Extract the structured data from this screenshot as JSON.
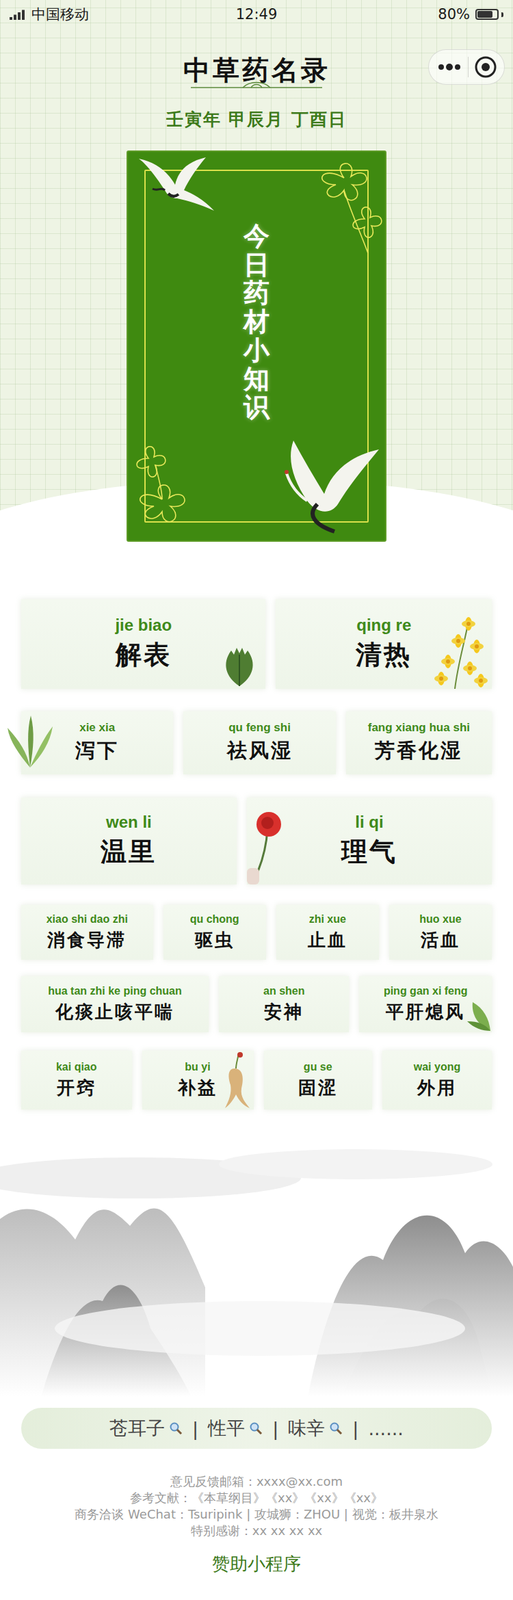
{
  "status_bar": {
    "carrier": "中国移动",
    "time": "12:49",
    "battery": "80%",
    "battery_level": 0.8,
    "signal_bars": 4
  },
  "header": {
    "title": "中草药名录",
    "date": "壬寅年 甲辰月 丁酉日"
  },
  "feature_card": {
    "title": "今日药材小知识"
  },
  "category_rows": [
    {
      "items": [
        {
          "pinyin": "jie biao",
          "name": "解表"
        },
        {
          "pinyin": "qing re",
          "name": "清热"
        }
      ]
    },
    {
      "items": [
        {
          "pinyin": "xie xia",
          "name": "泻下"
        },
        {
          "pinyin": "qu feng shi",
          "name": "祛风湿"
        },
        {
          "pinyin": "fang xiang hua shi",
          "name": "芳香化湿"
        }
      ]
    },
    {
      "items": [
        {
          "pinyin": "wen li",
          "name": "温里"
        },
        {
          "pinyin": "li qi",
          "name": "理气"
        }
      ]
    },
    {
      "items": [
        {
          "pinyin": "xiao shi dao zhi",
          "name": "消食导滞"
        },
        {
          "pinyin": "qu chong",
          "name": "驱虫"
        },
        {
          "pinyin": "zhi xue",
          "name": "止血"
        },
        {
          "pinyin": "huo xue",
          "name": "活血"
        }
      ]
    },
    {
      "items": [
        {
          "pinyin": "hua tan zhi ke ping chuan",
          "name": "化痰止咳平喘"
        },
        {
          "pinyin": "an shen",
          "name": "安神"
        },
        {
          "pinyin": "ping gan xi feng",
          "name": "平肝熄风"
        }
      ]
    },
    {
      "items": [
        {
          "pinyin": "kai qiao",
          "name": "开窍"
        },
        {
          "pinyin": "bu yi",
          "name": "补益"
        },
        {
          "pinyin": "gu se",
          "name": "固涩"
        },
        {
          "pinyin": "wai yong",
          "name": "外用"
        }
      ]
    }
  ],
  "search": {
    "hints": [
      "苍耳子",
      "性平",
      "味辛"
    ],
    "separator": "|",
    "more": "......"
  },
  "footer": {
    "lines": [
      "意见反馈邮箱：xxxx@xx.com",
      "参考文献：《本草纲目》《xx》《xx》《xx》",
      "商务洽谈 WeChat：Tsuripink | 攻城狮：ZHOU | 视觉：板井泉水",
      "特别感谢：xx xx xx xx"
    ],
    "sponsor": "赞助小程序"
  }
}
